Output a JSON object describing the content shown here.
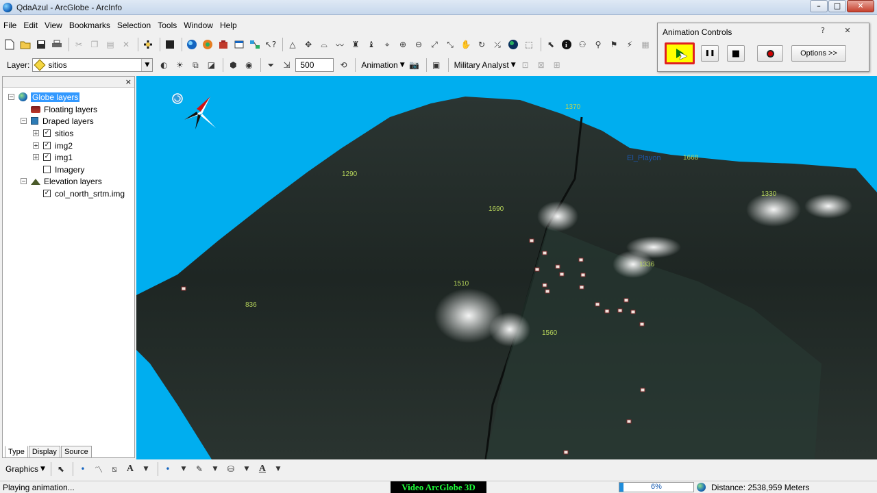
{
  "window": {
    "title": "QdaAzul - ArcGlobe - ArcInfo",
    "minimize": "–",
    "maximize": "□",
    "close": "✕"
  },
  "menu": [
    {
      "label": "File"
    },
    {
      "label": "Edit"
    },
    {
      "label": "View"
    },
    {
      "label": "Bookmarks"
    },
    {
      "label": "Selection"
    },
    {
      "label": "Tools"
    },
    {
      "label": "Window"
    },
    {
      "label": "Help"
    }
  ],
  "toolbar2": {
    "layer_label": "Layer:",
    "layer_value": "sitios",
    "scale_value": "500",
    "animation_label": "Animation",
    "military_label": "Military Analyst"
  },
  "toc": {
    "close": "×",
    "items": [
      {
        "label": "Globe layers",
        "expander": "−",
        "icon": "globe-icon",
        "selected": true
      },
      {
        "label": "Floating layers",
        "icon": "floating-layers-icon"
      },
      {
        "label": "Draped layers",
        "expander": "−",
        "icon": "draped-layers-icon"
      },
      {
        "label": "sitios",
        "expander": "+",
        "checked": true
      },
      {
        "label": "img2",
        "expander": "+",
        "checked": true
      },
      {
        "label": "img1",
        "expander": "+",
        "checked": true
      },
      {
        "label": "Imagery",
        "checked": false
      },
      {
        "label": "Elevation layers",
        "expander": "−",
        "icon": "elevation-layers-icon"
      },
      {
        "label": "col_north_srtm.img",
        "checked": true
      }
    ],
    "check_mark": "✓",
    "tabs": [
      {
        "label": "Type"
      },
      {
        "label": "Display"
      },
      {
        "label": "Source"
      }
    ]
  },
  "globe": {
    "elevation_labels": [
      "1290",
      "1690",
      "1510",
      "836",
      "1560",
      "1668",
      "1336",
      "1330",
      "1370"
    ],
    "place_labels": [
      "El_Playon"
    ],
    "colors": {
      "sky": "#00aeef",
      "terrain": "#1f2a26",
      "label_elev": "#b5d35a",
      "label_place": "#1d56a8"
    }
  },
  "animation_controls": {
    "title": "Animation Controls",
    "help": "?",
    "close": "✕",
    "pause_icon": "❚❚",
    "stop_icon": "■",
    "options_label": "Options >>"
  },
  "drawbar": {
    "graphics_label": "Graphics"
  },
  "status": {
    "message": "Playing animation...",
    "video_banner": "Video ArcGlobe 3D",
    "progress_text": "6%",
    "progress_fraction": 0.06,
    "distance": "Distance:  2538,959 Meters"
  }
}
